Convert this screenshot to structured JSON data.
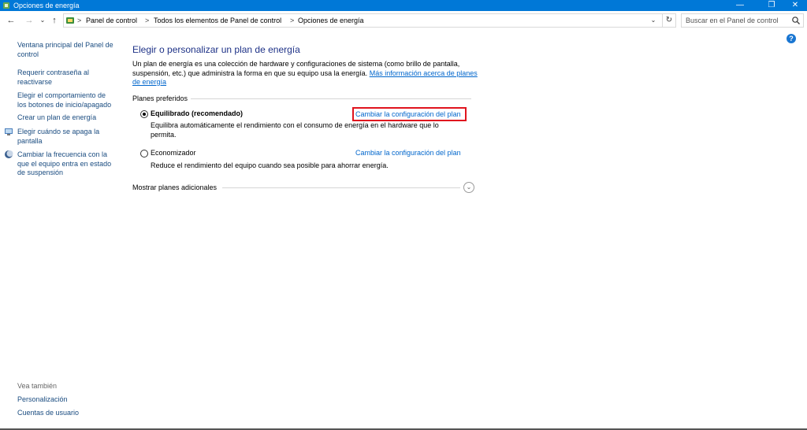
{
  "window": {
    "title": "Opciones de energía",
    "controls": {
      "minimize": "—",
      "restore": "❐",
      "close": "✕"
    }
  },
  "navigation": {
    "back": "←",
    "forward": "→",
    "dropdown": "⌄",
    "up": "↑",
    "breadcrumb": [
      "Panel de control",
      "Todos los elementos de Panel de control",
      "Opciones de energía"
    ],
    "breadcrumb_separator": ">",
    "refresh": "↻",
    "search_placeholder": "Buscar en el Panel de control"
  },
  "help": "?",
  "sidebar": {
    "items": [
      {
        "label": "Ventana principal del Panel de control",
        "icon": ""
      },
      {
        "label": "Requerir contraseña al reactivarse",
        "icon": ""
      },
      {
        "label": "Elegir el comportamiento de los botones de inicio/apagado",
        "icon": ""
      },
      {
        "label": "Crear un plan de energía",
        "icon": ""
      },
      {
        "label": "Elegir cuándo se apaga la pantalla",
        "icon": "monitor-clock-icon"
      },
      {
        "label": "Cambiar la frecuencia con la que el equipo entra en estado de suspensión",
        "icon": "moon-icon"
      }
    ],
    "see_also": {
      "heading": "Vea también",
      "links": [
        "Personalización",
        "Cuentas de usuario"
      ]
    }
  },
  "main": {
    "title": "Elegir o personalizar un plan de energía",
    "intro_text": "Un plan de energía es una colección de hardware y configuraciones de sistema (como brillo de pantalla, suspensión, etc.) que administra la forma en que su equipo usa la energía.",
    "intro_link": "Más información acerca de planes de energía",
    "preferred_label": "Planes preferidos",
    "plans": [
      {
        "name": "Equilibrado (recomendado)",
        "selected": true,
        "description": "Equilibra automáticamente el rendimiento con el consumo de energía en el hardware que lo permita.",
        "link": "Cambiar la configuración del plan"
      },
      {
        "name": "Economizador",
        "selected": false,
        "description": "Reduce el rendimiento del equipo cuando sea posible para ahorrar energía.",
        "link": "Cambiar la configuración del plan"
      }
    ],
    "more_plans_label": "Mostrar planes adicionales",
    "more_plans_icon": "⌄"
  },
  "colors": {
    "titlebar": "#0078d7",
    "link": "#0066cc",
    "sidebar_link": "#1a4c80",
    "heading": "#1e3287",
    "highlight": "#e0141e"
  }
}
